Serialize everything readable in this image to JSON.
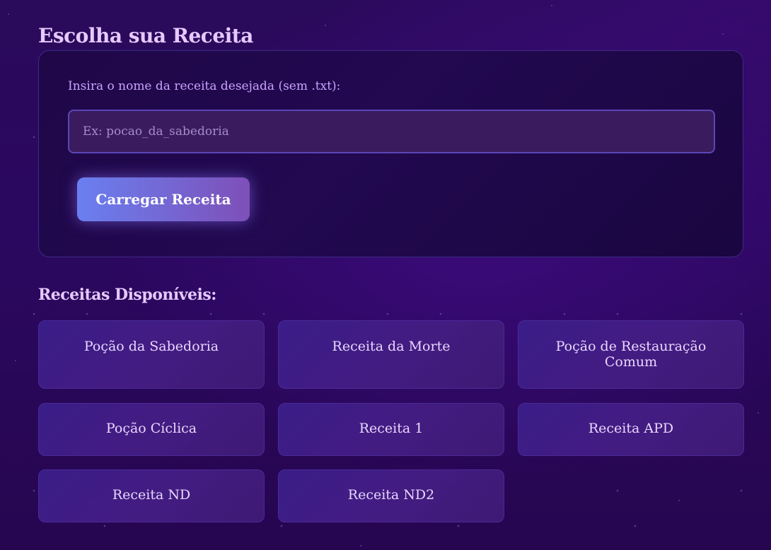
{
  "page": {
    "title": "Escolha sua Receita"
  },
  "form": {
    "label": "Insira o nome da receita desejada (sem .txt):",
    "input_value": "",
    "input_placeholder": "Ex: pocao_da_sabedoria",
    "button_label": "Carregar Receita"
  },
  "recipes": {
    "title": "Receitas Disponíveis:",
    "items": [
      {
        "label": "Poção da Sabedoria"
      },
      {
        "label": "Receita da Morte"
      },
      {
        "label": "Poção de Restauração Comum"
      },
      {
        "label": "Poção Cíclica"
      },
      {
        "label": "Receita 1"
      },
      {
        "label": "Receita APD"
      },
      {
        "label": "Receita ND"
      },
      {
        "label": "Receita ND2"
      }
    ]
  },
  "colors": {
    "background": "#2a0a5a",
    "panel": "#1f0748",
    "accent_start": "#6a7ff0",
    "accent_end": "#7e4fb8",
    "heading": "#e7c9ff",
    "label": "#c9a3ff",
    "card": "#3a1d88"
  }
}
